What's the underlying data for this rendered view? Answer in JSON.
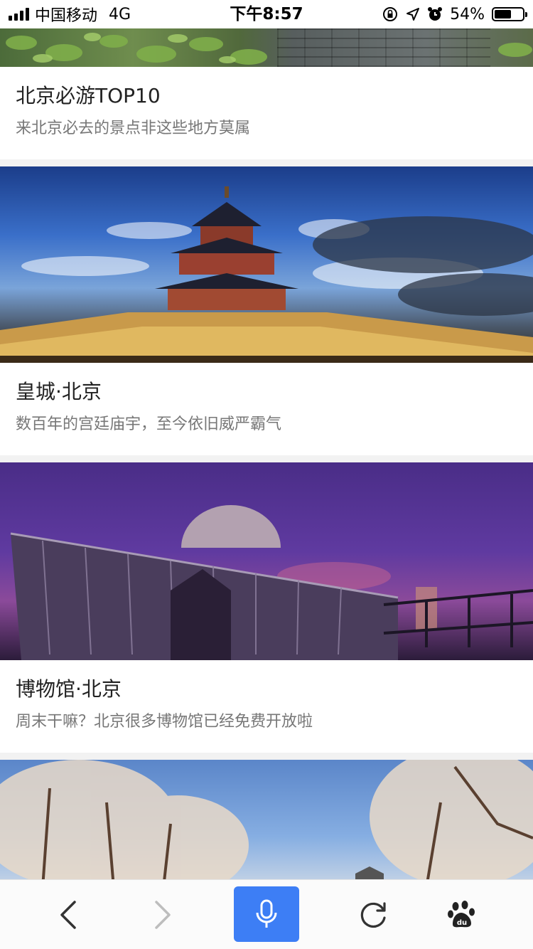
{
  "status_bar": {
    "carrier": "中国移动",
    "network": "4G",
    "time": "下午8:57",
    "battery_text": "54%",
    "battery_level": 0.54,
    "icons": [
      "signal-icon",
      "orientation-lock-icon",
      "location-icon",
      "alarm-icon",
      "battery-icon"
    ]
  },
  "feed": {
    "cards": [
      {
        "title": "北京必游TOP10",
        "subtitle": "来北京必去的景点非这些地方莫属"
      },
      {
        "title": "皇城·北京",
        "subtitle": "数百年的宫廷庙宇，至今依旧威严霸气"
      },
      {
        "title": "博物馆·北京",
        "subtitle": "周末干嘛？北京很多博物馆已经免费开放啦"
      }
    ]
  },
  "bottom_nav": {
    "items": [
      "back-icon",
      "forward-icon",
      "microphone-icon",
      "refresh-icon",
      "baidu-paw-icon"
    ],
    "accent_color": "#3d7ef5",
    "forward_enabled": false
  }
}
